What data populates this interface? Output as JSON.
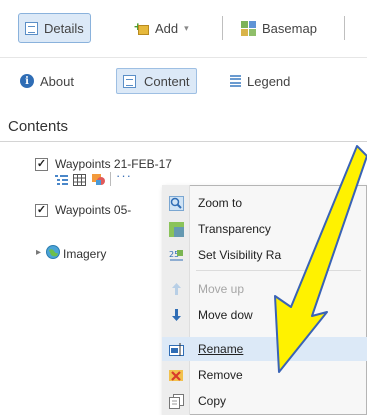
{
  "toolbar": {
    "details_label": "Details",
    "add_label": "Add",
    "basemap_label": "Basemap"
  },
  "tabs": {
    "about_label": "About",
    "content_label": "Content",
    "legend_label": "Legend"
  },
  "contents": {
    "title": "Contents",
    "layers": [
      {
        "name": "Waypoints 21-FEB-17",
        "checked": true
      },
      {
        "name": "Waypoints 05-",
        "checked": true
      },
      {
        "name": "Imagery",
        "checked": false
      }
    ],
    "more_label": "···",
    "check_mark": "✓",
    "expand_arrow": "▸"
  },
  "context_menu": {
    "items": [
      {
        "label": "Zoom to",
        "icon": "zoom-icon",
        "enabled": true
      },
      {
        "label": "Transparency",
        "icon": "transparency-icon",
        "enabled": true
      },
      {
        "label": "Set Visibility Ra",
        "icon": "visibility-range-icon",
        "enabled": true
      },
      {
        "label": "Move up",
        "icon": "arrow-up-icon",
        "enabled": false
      },
      {
        "label": "Move dow",
        "icon": "arrow-down-icon",
        "enabled": true
      },
      {
        "label": "Rename",
        "icon": "rename-icon",
        "enabled": true,
        "highlighted": true
      },
      {
        "label": "Remove",
        "icon": "remove-icon",
        "enabled": true
      },
      {
        "label": "Copy",
        "icon": "copy-icon",
        "enabled": true
      }
    ]
  },
  "colors": {
    "accent": "#2f6db5",
    "active_bg": "#dce9f7",
    "annotation_arrow": "#fff200",
    "annotation_outline": "#3a63b5"
  }
}
